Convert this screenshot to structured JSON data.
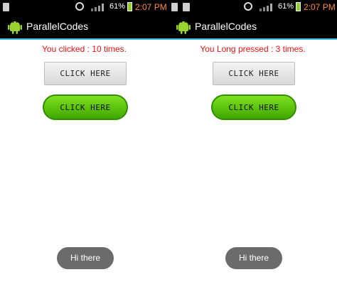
{
  "screens": [
    {
      "status_bar": {
        "battery_percent": "61%",
        "time": "2:07 PM",
        "icons": [
          "notification-icon",
          "alarm-icon",
          "signal-icon",
          "battery-icon"
        ]
      },
      "app_bar": {
        "title": "ParallelCodes",
        "icon": "android-icon"
      },
      "message": "You clicked : 10 times.",
      "buttons": {
        "gray_label": "CLICK HERE",
        "green_label": "CLICK HERE"
      },
      "toast": "Hi there"
    },
    {
      "status_bar": {
        "battery_percent": "61%",
        "time": "2:07 PM",
        "icons": [
          "image-icon",
          "notification-icon",
          "alarm-icon",
          "signal-icon",
          "battery-icon"
        ]
      },
      "app_bar": {
        "title": "ParallelCodes",
        "icon": "android-icon"
      },
      "message": "You Long pressed : 3 times.",
      "buttons": {
        "gray_label": "CLICK HERE",
        "green_label": "CLICK HERE"
      },
      "toast": "Hi there"
    }
  ],
  "colors": {
    "message_text": "#ee1111",
    "green_button": "#5cc40a",
    "app_bar_divider": "#35b5e5",
    "time_text": "#ff8a3d"
  }
}
